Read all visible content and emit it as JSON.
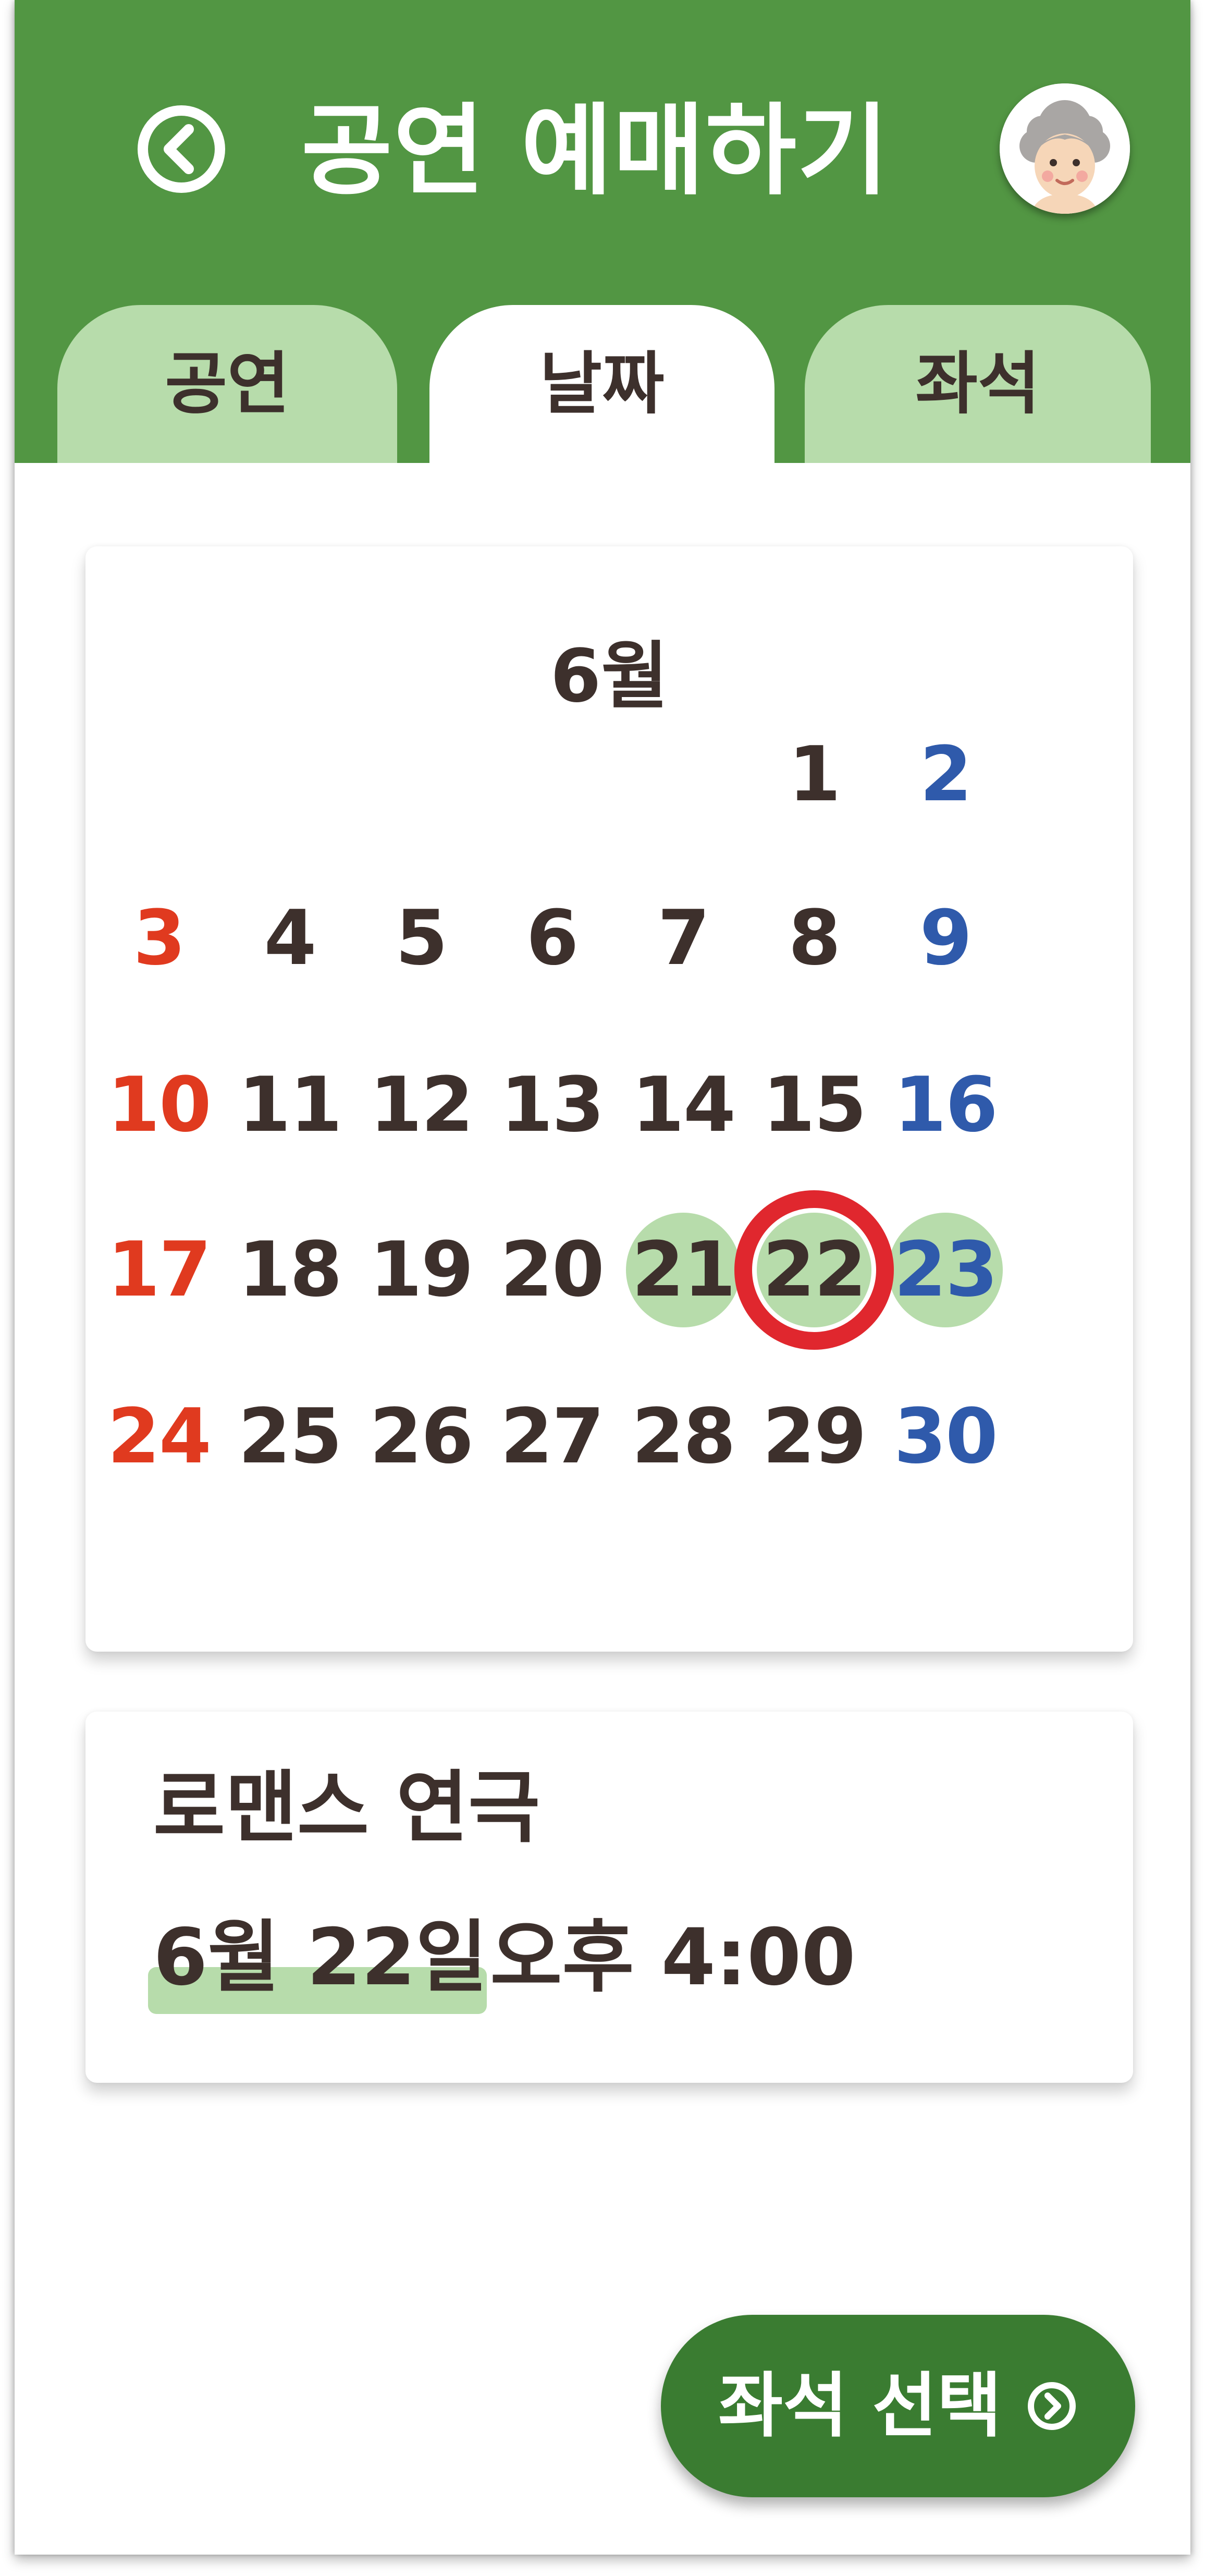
{
  "header": {
    "title": "공연 예매하기",
    "back_icon": "back-arrow-circle-icon",
    "avatar": "grandmother-avatar"
  },
  "tabs": [
    {
      "label": "공연",
      "active": false
    },
    {
      "label": "날짜",
      "active": true
    },
    {
      "label": "좌석",
      "active": false
    }
  ],
  "calendar": {
    "month_label": "6월",
    "days": [
      "1",
      "2",
      "3",
      "4",
      "5",
      "6",
      "7",
      "8",
      "9",
      "10",
      "11",
      "12",
      "13",
      "14",
      "15",
      "16",
      "17",
      "18",
      "19",
      "20",
      "21",
      "22",
      "23",
      "24",
      "25",
      "26",
      "27",
      "28",
      "29",
      "30"
    ],
    "available_days": [
      "21",
      "22",
      "23"
    ],
    "selected_day": "22",
    "colors": {
      "sunday": "#e03a1f",
      "saturday": "#2f5aab",
      "weekday": "#3d302c",
      "available": "#b7dcab",
      "selected_ring": "#e0272e"
    }
  },
  "summary": {
    "show_title": "로맨스 연극",
    "date": "6월 22일",
    "time": "오후 4:00"
  },
  "cta": {
    "label": "좌석 선택",
    "icon": "chevron-right-circle-icon"
  },
  "colors": {
    "header_green": "#529643",
    "tab_green": "#b7dcab",
    "button_green": "#3a7c31",
    "text_dark": "#3d302c"
  }
}
